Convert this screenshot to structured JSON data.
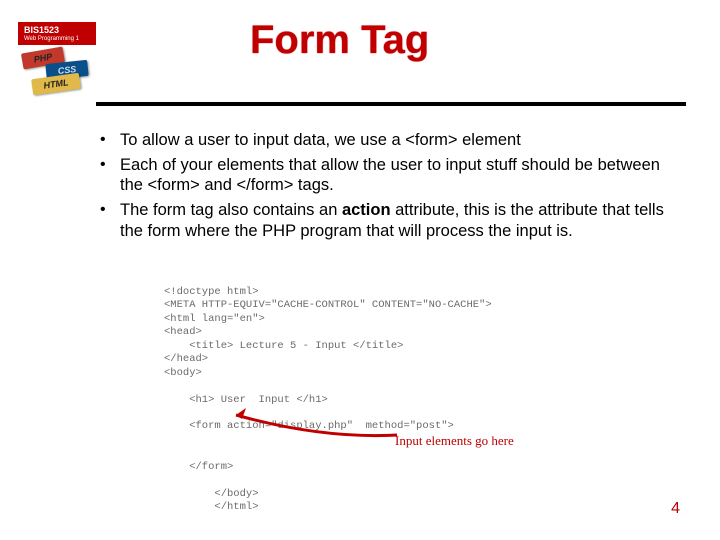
{
  "logo": {
    "code": "BIS1523",
    "subtitle": "Web Programming 1",
    "bricks": {
      "php": "PHP",
      "css": "CSS",
      "html": "HTML"
    }
  },
  "title": "Form Tag",
  "bullets": [
    "To allow a user to input data, we use a <form> element",
    "Each of your elements that allow the user to input stuff should be between the <form> and </form> tags.",
    "The form tag also contains an **action** attribute, this is the attribute that tells the form where the PHP program that will process the input is."
  ],
  "code": {
    "lines": [
      "<!doctype html>",
      "<META HTTP-EQUIV=\"CACHE-CONTROL\" CONTENT=\"NO-CACHE\">",
      "<html lang=\"en\">",
      "<head>",
      "    <title> Lecture 5 - Input </title>",
      "</head>",
      "<body>",
      "",
      "    <h1> User  Input </h1>",
      "",
      "    <form action=\"display.php\"  method=\"post\">",
      "",
      "",
      "    </form>",
      "",
      "        </body>",
      "        </html>"
    ]
  },
  "annotation": "Input elements go here",
  "page_number": "4"
}
